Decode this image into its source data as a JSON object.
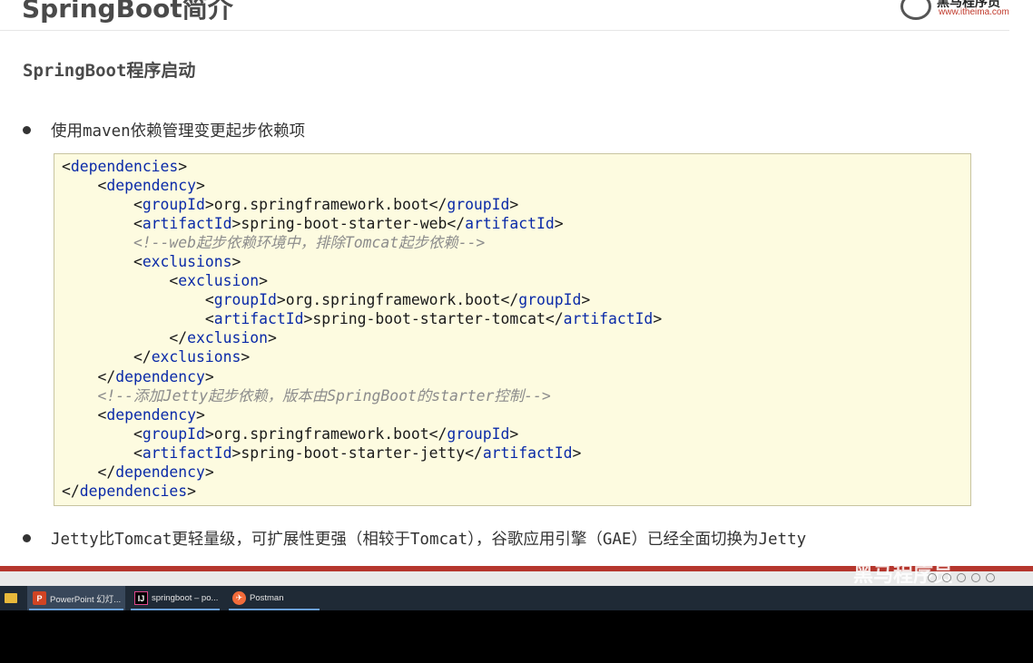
{
  "slide": {
    "title": "SpringBoot简介",
    "logo_name": "黑马程序员",
    "logo_url": "www.itheima.com",
    "subtitle": "SpringBoot程序启动",
    "bullet_1": "使用maven依赖管理变更起步依赖项",
    "bullet_2": "Jetty比Tomcat更轻量级，可扩展性更强（相较于Tomcat），谷歌应用引擎（GAE）已经全面切换为Jetty",
    "watermark": "黑马程序员",
    "code_lines": [
      [
        {
          "t": "<",
          "c": ""
        },
        {
          "t": "dependencies",
          "c": "tag"
        },
        {
          "t": ">",
          "c": ""
        }
      ],
      [
        {
          "t": "    <",
          "c": ""
        },
        {
          "t": "dependency",
          "c": "tag"
        },
        {
          "t": ">",
          "c": ""
        }
      ],
      [
        {
          "t": "        <",
          "c": ""
        },
        {
          "t": "groupId",
          "c": "tag"
        },
        {
          "t": ">org.springframework.boot</",
          "c": ""
        },
        {
          "t": "groupId",
          "c": "tag"
        },
        {
          "t": ">",
          "c": ""
        }
      ],
      [
        {
          "t": "        <",
          "c": ""
        },
        {
          "t": "artifactId",
          "c": "tag"
        },
        {
          "t": ">spring-boot-starter-web</",
          "c": ""
        },
        {
          "t": "artifactId",
          "c": "tag"
        },
        {
          "t": ">",
          "c": ""
        }
      ],
      [
        {
          "t": "        <!--web起步依赖环境中，排除Tomcat起步依赖-->",
          "c": "cmt"
        }
      ],
      [
        {
          "t": "        <",
          "c": ""
        },
        {
          "t": "exclusions",
          "c": "tag"
        },
        {
          "t": ">",
          "c": ""
        }
      ],
      [
        {
          "t": "            <",
          "c": ""
        },
        {
          "t": "exclusion",
          "c": "tag"
        },
        {
          "t": ">",
          "c": ""
        }
      ],
      [
        {
          "t": "                <",
          "c": ""
        },
        {
          "t": "groupId",
          "c": "tag"
        },
        {
          "t": ">org.springframework.boot</",
          "c": ""
        },
        {
          "t": "groupId",
          "c": "tag"
        },
        {
          "t": ">",
          "c": ""
        }
      ],
      [
        {
          "t": "                <",
          "c": ""
        },
        {
          "t": "artifactId",
          "c": "tag"
        },
        {
          "t": ">spring-boot-starter-tomcat</",
          "c": ""
        },
        {
          "t": "artifactId",
          "c": "tag"
        },
        {
          "t": ">",
          "c": ""
        }
      ],
      [
        {
          "t": "            </",
          "c": ""
        },
        {
          "t": "exclusion",
          "c": "tag"
        },
        {
          "t": ">",
          "c": ""
        }
      ],
      [
        {
          "t": "        </",
          "c": ""
        },
        {
          "t": "exclusions",
          "c": "tag"
        },
        {
          "t": ">",
          "c": ""
        }
      ],
      [
        {
          "t": "    </",
          "c": ""
        },
        {
          "t": "dependency",
          "c": "tag"
        },
        {
          "t": ">",
          "c": ""
        }
      ],
      [
        {
          "t": "    <!--添加Jetty起步依赖，版本由SpringBoot的starter控制-->",
          "c": "cmt"
        }
      ],
      [
        {
          "t": "    <",
          "c": ""
        },
        {
          "t": "dependency",
          "c": "tag"
        },
        {
          "t": ">",
          "c": ""
        }
      ],
      [
        {
          "t": "        <",
          "c": ""
        },
        {
          "t": "groupId",
          "c": "tag"
        },
        {
          "t": ">org.springframework.boot</",
          "c": ""
        },
        {
          "t": "groupId",
          "c": "tag"
        },
        {
          "t": ">",
          "c": ""
        }
      ],
      [
        {
          "t": "        <",
          "c": ""
        },
        {
          "t": "artifactId",
          "c": "tag"
        },
        {
          "t": ">spring-boot-starter-jetty</",
          "c": ""
        },
        {
          "t": "artifactId",
          "c": "tag"
        },
        {
          "t": ">",
          "c": ""
        }
      ],
      [
        {
          "t": "    </",
          "c": ""
        },
        {
          "t": "dependency",
          "c": "tag"
        },
        {
          "t": ">",
          "c": ""
        }
      ],
      [
        {
          "t": "</",
          "c": ""
        },
        {
          "t": "dependencies",
          "c": "tag"
        },
        {
          "t": ">",
          "c": ""
        }
      ]
    ]
  },
  "taskbar": {
    "items": [
      {
        "label": "PowerPoint 幻灯...",
        "icon": "powerpoint-icon",
        "glyph": "P"
      },
      {
        "label": "springboot – po...",
        "icon": "intellij-idea-icon",
        "glyph": "IJ"
      },
      {
        "label": "Postman",
        "icon": "postman-icon",
        "glyph": "✈"
      }
    ]
  },
  "colors": {
    "code_background": "#fdfbe0",
    "xml_tag": "#0a2aa8",
    "comment": "#8c8c8c",
    "accent_band": "#b5362d",
    "taskbar": "#1f2a36"
  }
}
